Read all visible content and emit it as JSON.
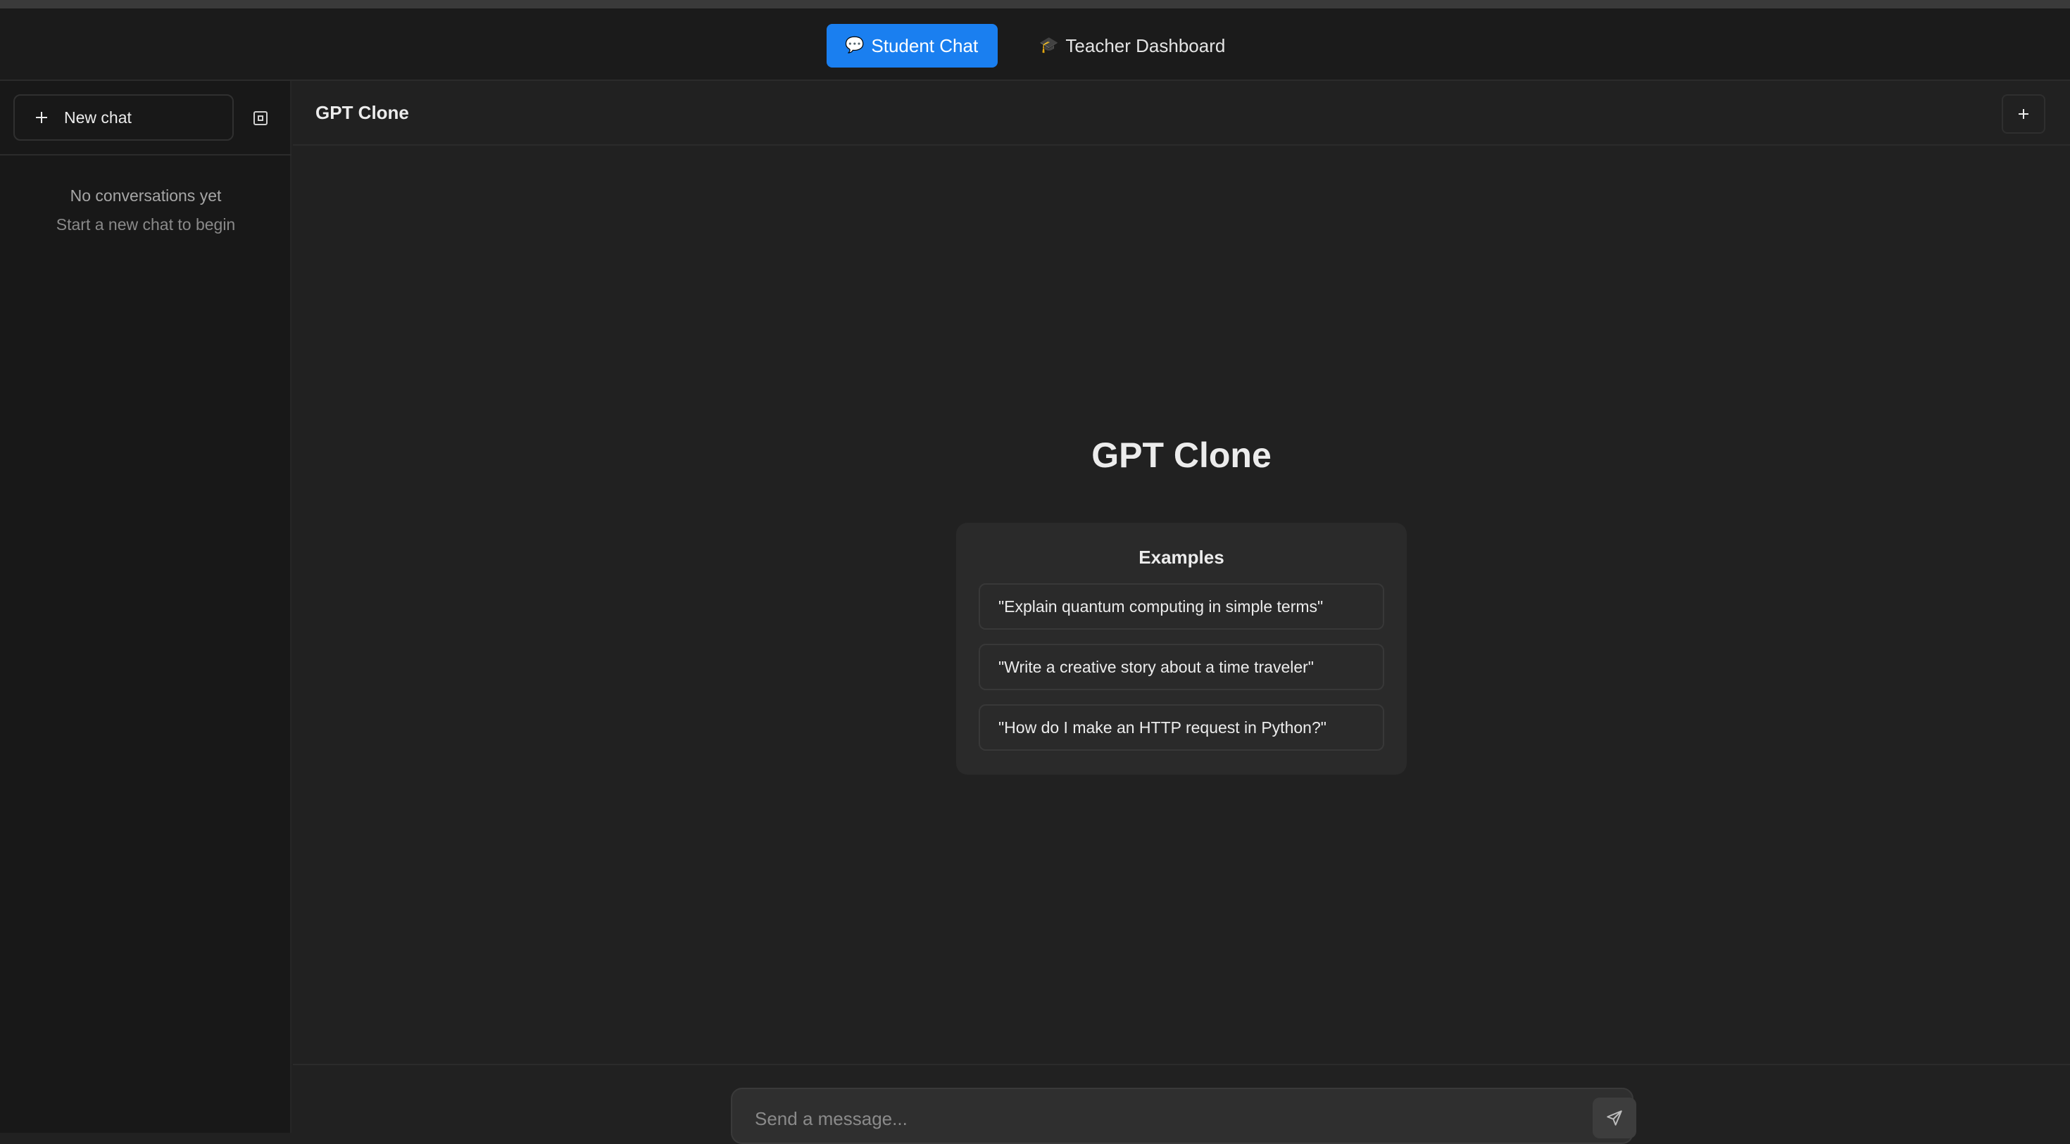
{
  "app_nav": {
    "tabs": [
      {
        "label": "Student Chat",
        "icon": "speech-bubble-icon",
        "active": true
      },
      {
        "label": "Teacher Dashboard",
        "icon": "graduation-cap-icon",
        "active": false
      }
    ],
    "accent_color": "#1a7ff0"
  },
  "sidebar": {
    "new_chat_label": "New chat",
    "empty_title": "No conversations yet",
    "empty_subtitle": "Start a new chat to begin"
  },
  "main": {
    "header_title": "GPT Clone",
    "hero_title": "GPT Clone",
    "examples": {
      "title": "Examples",
      "items": [
        "\"Explain quantum computing in simple terms\"",
        "\"Write a creative story about a time traveler\"",
        "\"How do I make an HTTP request in Python?\""
      ]
    }
  },
  "composer": {
    "placeholder": "Send a message...",
    "value": ""
  }
}
